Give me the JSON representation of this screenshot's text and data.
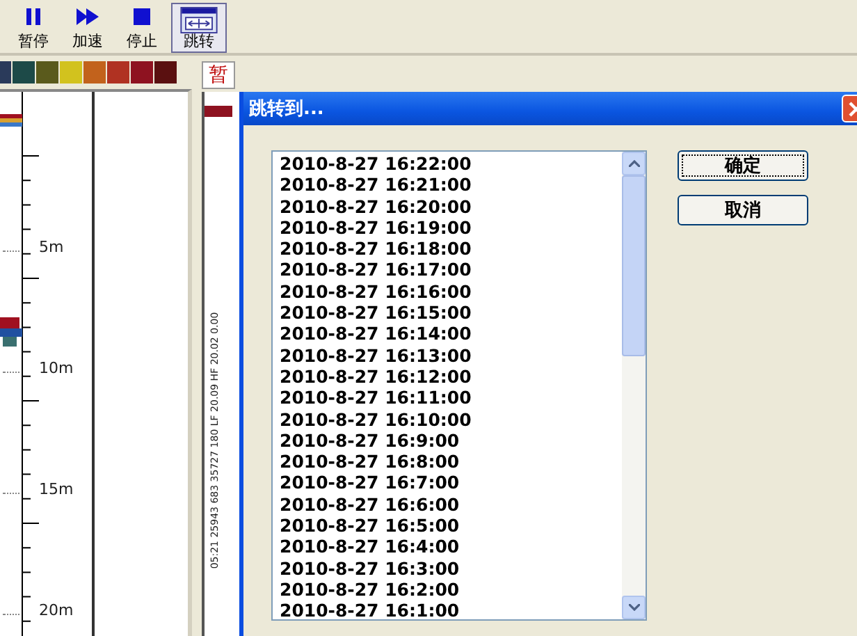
{
  "toolbar": [
    {
      "kind": "pause",
      "label": "暂停",
      "selected": false
    },
    {
      "kind": "fast",
      "label": "加速",
      "selected": false
    },
    {
      "kind": "stop",
      "label": "停止",
      "selected": false
    },
    {
      "kind": "jump",
      "label": "跳转",
      "selected": true
    }
  ],
  "legend": [
    {
      "color": "#2a3a5a"
    },
    {
      "color": "#1d4a48"
    },
    {
      "color": "#5a5a1c"
    },
    {
      "color": "#d2c21e"
    },
    {
      "color": "#c2621c"
    },
    {
      "color": "#b03222"
    },
    {
      "color": "#8e1220"
    },
    {
      "color": "#5a1010"
    }
  ],
  "depth_labels": [
    "5m",
    "10m",
    "15m",
    "20m"
  ],
  "track": {
    "label": "暂",
    "readout": "05:21 25943 683 35727 180 LF 20.09 HF 20.02 0.00"
  },
  "dialog": {
    "title": "跳转到...",
    "times": [
      "2010-8-27 16:22:00",
      "2010-8-27 16:21:00",
      "2010-8-27 16:20:00",
      "2010-8-27 16:19:00",
      "2010-8-27 16:18:00",
      "2010-8-27 16:17:00",
      "2010-8-27 16:16:00",
      "2010-8-27 16:15:00",
      "2010-8-27 16:14:00",
      "2010-8-27 16:13:00",
      "2010-8-27 16:12:00",
      "2010-8-27 16:11:00",
      "2010-8-27 16:10:00",
      "2010-8-27 16:9:00",
      "2010-8-27 16:8:00",
      "2010-8-27 16:7:00",
      "2010-8-27 16:6:00",
      "2010-8-27 16:5:00",
      "2010-8-27 16:4:00",
      "2010-8-27 16:3:00",
      "2010-8-27 16:2:00",
      "2010-8-27 16:1:00"
    ],
    "buttons": [
      "确定",
      "取消"
    ]
  }
}
